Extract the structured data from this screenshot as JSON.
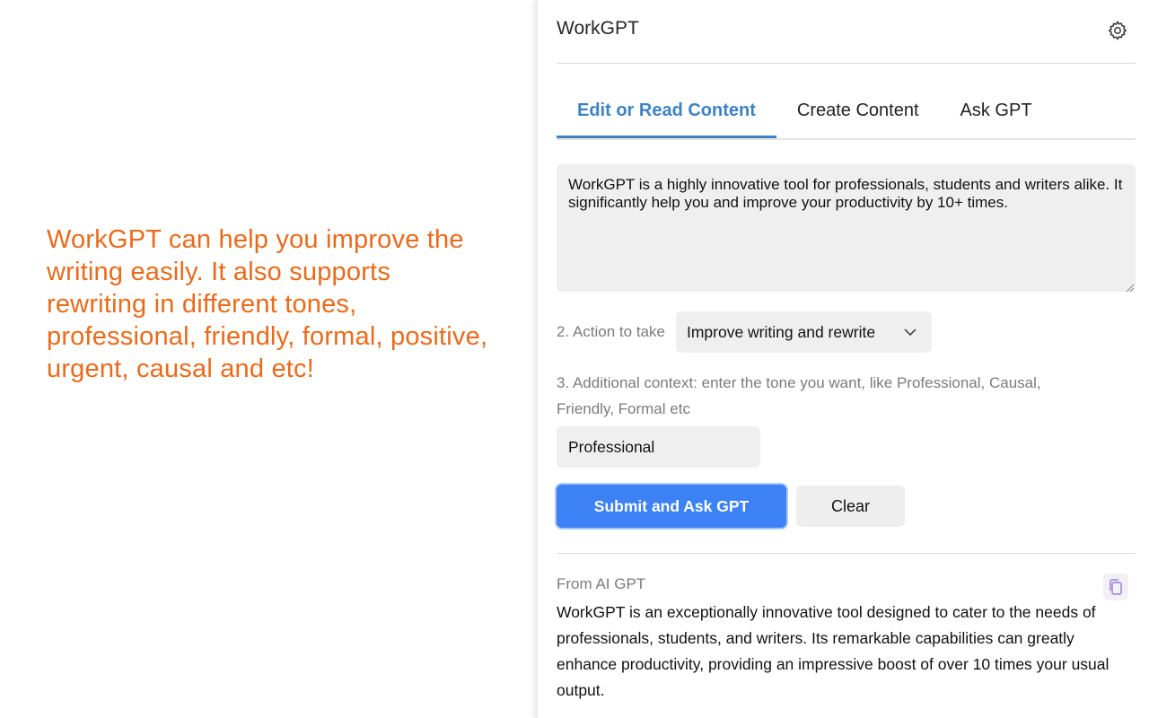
{
  "promo": {
    "text": "WorkGPT can help you improve the writing easily. It also supports rewriting in different tones, professional, friendly, formal, positive, urgent, causal and etc!",
    "color": "#ea6a1c"
  },
  "panel": {
    "title": "WorkGPT",
    "settings_icon": "gear-icon"
  },
  "tabs": [
    {
      "label": "Edit or Read Content",
      "active": true
    },
    {
      "label": "Create Content",
      "active": false
    },
    {
      "label": "Ask GPT",
      "active": false
    }
  ],
  "content": {
    "value": "WorkGPT is a highly innovative tool for professionals, students and writers alike. It significantly help you and improve your productivity by 10+ times."
  },
  "action": {
    "label": "2. Action to take",
    "selected": "Improve writing and rewrite"
  },
  "context": {
    "label": "3. Additional context: enter the tone you want, like Professional, Causal, Friendly, Formal etc",
    "value": "Professional"
  },
  "buttons": {
    "submit": "Submit and Ask GPT",
    "clear": "Clear"
  },
  "result": {
    "label": "From AI GPT",
    "text": "WorkGPT is an exceptionally innovative tool designed to cater to the needs of professionals, students, and writers. Its remarkable capabilities can greatly enhance productivity, providing an impressive boost of over 10 times your usual output.",
    "copy_icon": "copy-icon"
  },
  "colors": {
    "accent_tab": "#3d82c4",
    "primary_button": "#3c81f6",
    "muted_text": "#7b7b7b",
    "input_bg": "#efefef"
  }
}
